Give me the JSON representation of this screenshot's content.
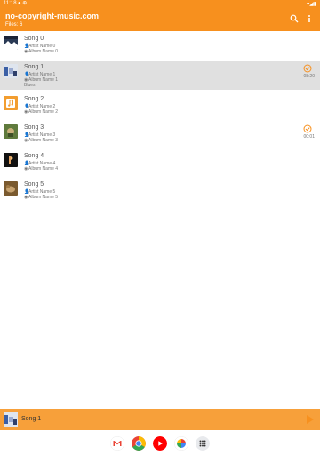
{
  "status": {
    "time": "11:18",
    "left_icons": "● ⊕",
    "right_icons": "▾◢▮"
  },
  "app": {
    "title": "no-copyright-music.com",
    "files_label": "Files: 6"
  },
  "songs": [
    {
      "title": "Song 0",
      "artist": "Artist Name 0",
      "album": "Album Name 0",
      "genre": "",
      "duration": "",
      "checked": false
    },
    {
      "title": "Song 1",
      "artist": "Artist Name 1",
      "album": "Album Name 1",
      "genre": "Blues",
      "duration": "08:20",
      "checked": true
    },
    {
      "title": "Song 2",
      "artist": "Artist Name 2",
      "album": "Album Name 2",
      "genre": "",
      "duration": "",
      "checked": false
    },
    {
      "title": "Song 3",
      "artist": "Artist Name 3",
      "album": "Album Name 3",
      "genre": "",
      "duration": "00:01",
      "checked": true
    },
    {
      "title": "Song 4",
      "artist": "Artist Name 4",
      "album": "Album Name 4",
      "genre": "",
      "duration": "",
      "checked": false
    },
    {
      "title": "Song 5",
      "artist": "Artist Name 5",
      "album": "Album Name 5",
      "genre": "",
      "duration": "",
      "checked": false
    }
  ],
  "player": {
    "now_playing": "Song 1"
  },
  "colors": {
    "accent": "#f7901e",
    "player_bg": "#f7a03a",
    "selected_row": "#e0e0e0"
  },
  "dock": [
    "gmail-icon",
    "chrome-icon",
    "youtube-icon",
    "photos-icon",
    "apps-icon"
  ]
}
